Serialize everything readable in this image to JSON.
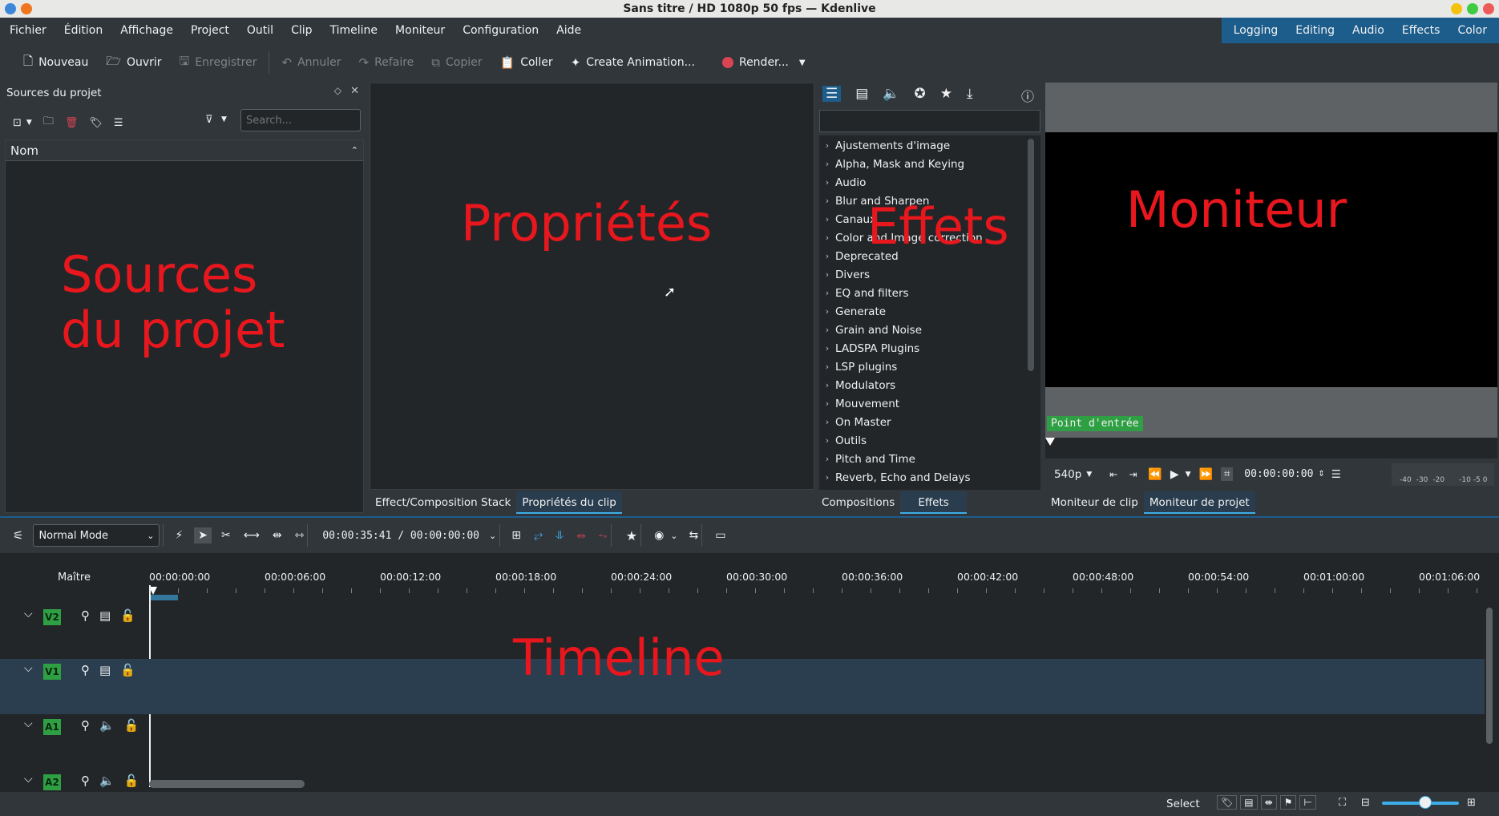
{
  "window": {
    "title": "Sans titre / HD 1080p 50 fps — Kdenlive"
  },
  "menu": [
    "Fichier",
    "Édition",
    "Affichage",
    "Project",
    "Outil",
    "Clip",
    "Timeline",
    "Moniteur",
    "Configuration",
    "Aide"
  ],
  "layouts": [
    "Logging",
    "Editing",
    "Audio",
    "Effects",
    "Color"
  ],
  "toolbar": {
    "new": "Nouveau",
    "open": "Ouvrir",
    "save": "Enregistrer",
    "undo": "Annuler",
    "redo": "Refaire",
    "copy": "Copier",
    "paste": "Coller",
    "animation": "Create Animation...",
    "render": "Render..."
  },
  "sources": {
    "title": "Sources du projet",
    "search_placeholder": "Search...",
    "column": "Nom",
    "overlay_line1": "Sources",
    "overlay_line2": "du projet"
  },
  "properties": {
    "overlay": "Propriétés"
  },
  "effects": {
    "overlay": "Effets",
    "categories": [
      "Ajustements d'image",
      "Alpha, Mask and Keying",
      "Audio",
      "Blur and Sharpen",
      "Canaux",
      "Color and Image correction",
      "Deprecated",
      "Divers",
      "EQ and filters",
      "Generate",
      "Grain and Noise",
      "LADSPA Plugins",
      "LSP plugins",
      "Modulators",
      "Mouvement",
      "On Master",
      "Outils",
      "Pitch and Time",
      "Reverb, Echo and Delays"
    ]
  },
  "monitor": {
    "overlay": "Moniteur",
    "in_point": "Point d'entrée",
    "resolution": "540p",
    "timecode": "00:00:00:00",
    "vu_labels": [
      "-40",
      "-30",
      "-20",
      "-10",
      "-5",
      "0"
    ]
  },
  "tabs": {
    "left": [
      "Effect/Composition Stack",
      "Propriétés du clip"
    ],
    "middle": [
      "Compositions",
      "Effets"
    ],
    "right": [
      "Moniteur de clip",
      "Moniteur de projet"
    ]
  },
  "timeline": {
    "mode": "Normal Mode",
    "timecode": "00:00:35:41 / 00:00:00:00",
    "master": "Maître",
    "ruler": [
      "00:00:00:00",
      "00:00:06:00",
      "00:00:12:00",
      "00:00:18:00",
      "00:00:24:00",
      "00:00:30:00",
      "00:00:36:00",
      "00:00:42:00",
      "00:00:48:00",
      "00:00:54:00",
      "00:01:00:00",
      "00:01:06:00"
    ],
    "tracks": [
      "V2",
      "V1",
      "A1",
      "A2"
    ],
    "overlay": "Timeline"
  },
  "status": {
    "select": "Select"
  }
}
